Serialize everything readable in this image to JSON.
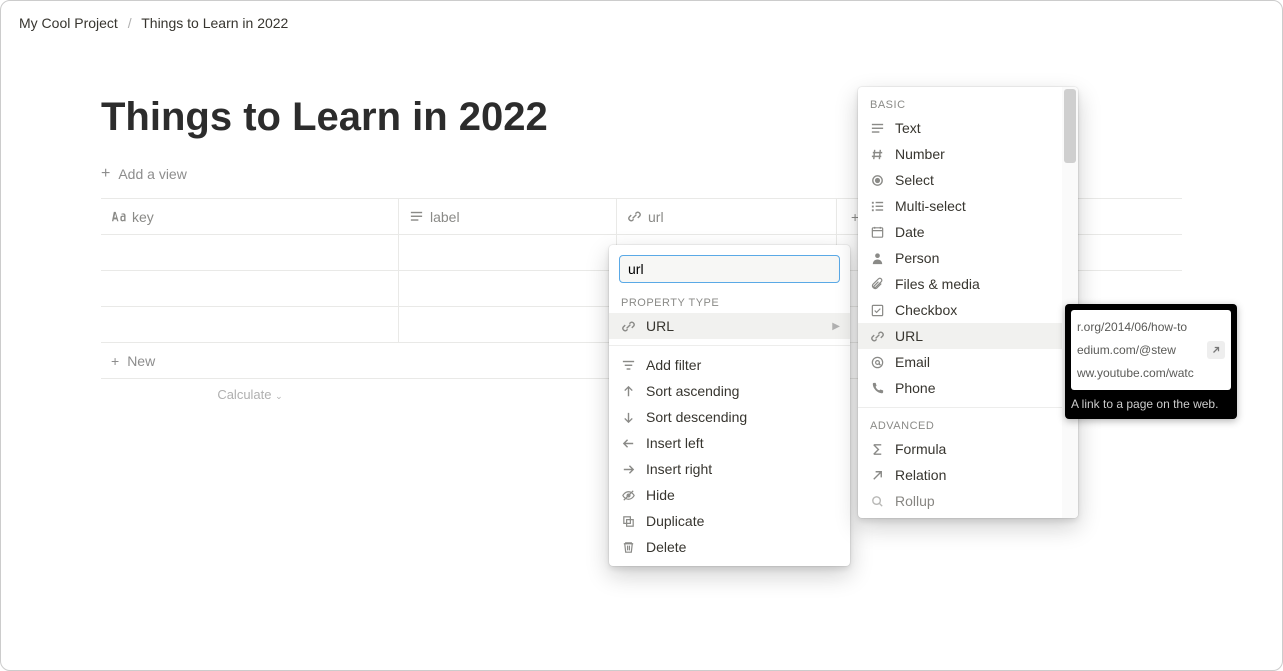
{
  "breadcrumb": {
    "root": "My Cool Project",
    "page": "Things to Learn in 2022"
  },
  "page": {
    "title": "Things to Learn in 2022",
    "addView": "Add a view",
    "newRow": "New",
    "calculate": "Calculate"
  },
  "columns": {
    "key": "key",
    "label": "label",
    "url": "url"
  },
  "colMenu": {
    "input": "url",
    "section": "PROPERTY TYPE",
    "type": "URL",
    "addFilter": "Add filter",
    "sortAsc": "Sort ascending",
    "sortDesc": "Sort descending",
    "insertLeft": "Insert left",
    "insertRight": "Insert right",
    "hide": "Hide",
    "duplicate": "Duplicate",
    "delete": "Delete"
  },
  "typeMenu": {
    "basic": "BASIC",
    "text": "Text",
    "number": "Number",
    "select": "Select",
    "multiSelect": "Multi-select",
    "date": "Date",
    "person": "Person",
    "files": "Files & media",
    "checkbox": "Checkbox",
    "url": "URL",
    "email": "Email",
    "phone": "Phone",
    "advanced": "ADVANCED",
    "formula": "Formula",
    "relation": "Relation",
    "rollup": "Rollup"
  },
  "tooltip": {
    "preview1": "r.org/2014/06/how-to",
    "preview2": "edium.com/@stew",
    "preview3": "ww.youtube.com/watc",
    "text": "A link to a page on the web."
  }
}
